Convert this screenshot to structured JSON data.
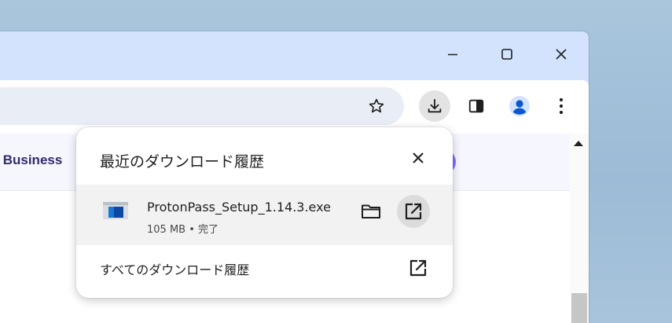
{
  "window": {
    "controls": [
      {
        "name": "minimize",
        "icon": "minimize-icon"
      },
      {
        "name": "maximize",
        "icon": "maximize-icon"
      },
      {
        "name": "close",
        "icon": "close-icon"
      }
    ]
  },
  "toolbar": {
    "icons": [
      "bookmark-star-icon",
      "download-icon",
      "side-panel-icon",
      "profile-icon",
      "more-menu-icon"
    ],
    "accent": "#0b57d0"
  },
  "page": {
    "banner_text": "or Business"
  },
  "download_panel": {
    "title": "最近のダウンロード履歴",
    "close_icon": "close-icon",
    "items": [
      {
        "file_name": "ProtonPass_Setup_1.14.3.exe",
        "status": "105 MB • 完了",
        "icon": "installer-file-icon",
        "actions": [
          "folder-icon",
          "open-external-icon"
        ]
      }
    ],
    "all_history_label": "すべてのダウンロード履歴",
    "all_history_icon": "open-external-icon"
  }
}
